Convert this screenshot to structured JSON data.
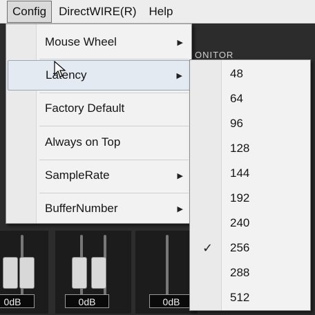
{
  "menubar": {
    "items": [
      {
        "label": "Config",
        "active": true
      },
      {
        "label": "DirectWIRE(R)",
        "active": false
      },
      {
        "label": "Help",
        "active": false
      }
    ]
  },
  "background": {
    "monitor_label": "ONITOR",
    "db_labels": [
      "0dB",
      "0dB",
      "0dB"
    ]
  },
  "config_menu": {
    "items": [
      {
        "label": "Mouse Wheel",
        "has_submenu": true
      },
      {
        "label": "Latency",
        "has_submenu": true,
        "highlighted": true
      },
      {
        "label": "Factory Default",
        "has_submenu": false
      },
      {
        "label": "Always on Top",
        "has_submenu": false
      },
      {
        "label": "SampleRate",
        "has_submenu": true
      },
      {
        "label": "BufferNumber",
        "has_submenu": true
      }
    ],
    "arrow_glyph": "▶"
  },
  "latency_submenu": {
    "options": [
      "48",
      "64",
      "96",
      "128",
      "144",
      "192",
      "240",
      "256",
      "288",
      "512"
    ],
    "selected": "256",
    "check_glyph": "✓"
  },
  "colors": {
    "menu_bg": "#f2f2f2",
    "highlight_bg": "#e4eaf1",
    "app_bg": "#2c2c2c"
  }
}
